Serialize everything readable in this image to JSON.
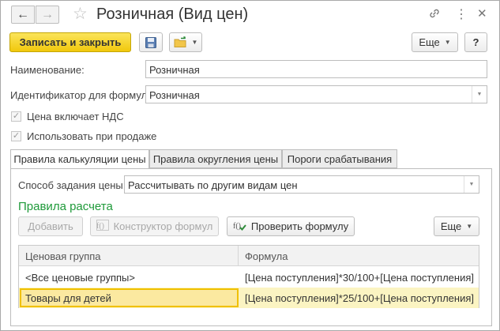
{
  "window": {
    "title": "Розничная (Вид цен)",
    "nav_back_glyph": "←",
    "nav_forward_glyph": "→",
    "icons": [
      "star-icon",
      "link-icon",
      "more-vertical-icon",
      "close-icon"
    ]
  },
  "toolbar": {
    "save_close_label": "Записать и закрыть",
    "more_label": "Еще",
    "help_label": "?"
  },
  "form": {
    "name_label": "Наименование:",
    "name_value": "Розничная",
    "formula_id_label": "Идентификатор для формул:",
    "formula_id_value": "Розничная",
    "vat_label": "Цена включает НДС",
    "vat_checked": true,
    "sale_label": "Использовать при продаже",
    "sale_checked": true
  },
  "tabs": [
    {
      "label": "Правила калькуляции цены",
      "active": true
    },
    {
      "label": "Правила округления цены",
      "active": false
    },
    {
      "label": "Пороги срабатывания",
      "active": false
    }
  ],
  "calc": {
    "method_label": "Способ задания цены:",
    "method_value": "Рассчитывать по другим видам цен",
    "rules_title": "Правила расчета",
    "add_label": "Добавить",
    "constructor_label": "Конструктор формул",
    "check_label": "Проверить формулу",
    "more_label": "Еще"
  },
  "table": {
    "columns": [
      "Ценовая группа",
      "Формула"
    ],
    "rows": [
      {
        "group": "<Все ценовые группы>",
        "formula": "[Цена поступления]*30/100+[Цена поступления]"
      },
      {
        "group": "Товары для детей",
        "formula": "[Цена поступления]*25/100+[Цена поступления]",
        "selected": true
      }
    ]
  },
  "colors": {
    "accent_yellow": "#f1c80c",
    "section_green": "#1f9a3a",
    "selection": "#fbf4c2"
  }
}
